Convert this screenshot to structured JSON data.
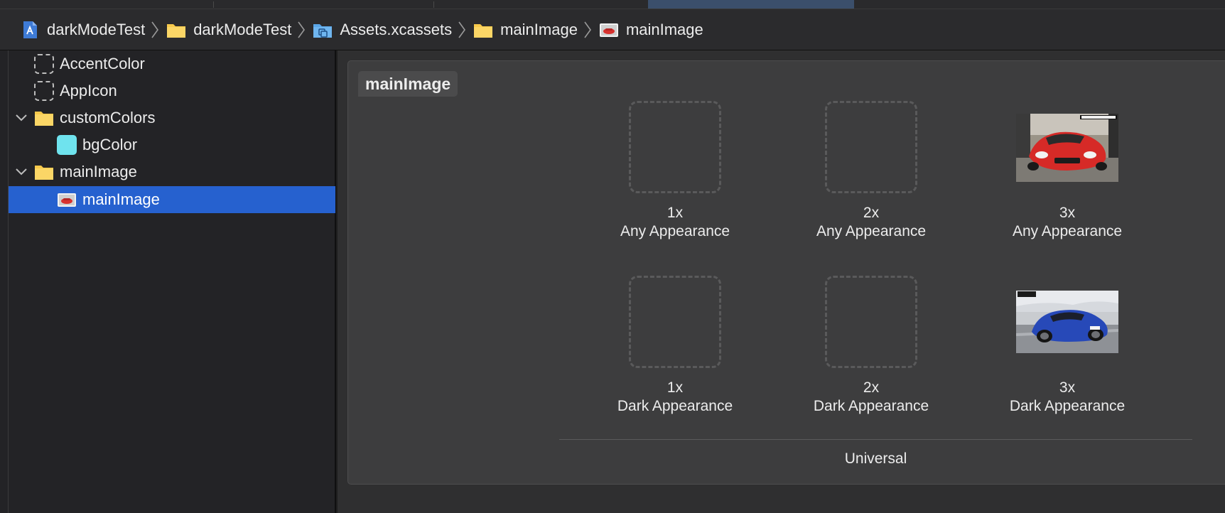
{
  "breadcrumb": [
    {
      "label": "darkModeTest",
      "icon": "project-icon"
    },
    {
      "label": "darkModeTest",
      "icon": "folder-icon"
    },
    {
      "label": "Assets.xcassets",
      "icon": "asset-catalog-icon"
    },
    {
      "label": "mainImage",
      "icon": "folder-icon"
    },
    {
      "label": "mainImage",
      "icon": "image-set-icon"
    }
  ],
  "sidebar": {
    "items": [
      {
        "label": "AccentColor",
        "icon": "color-set-dashed-icon",
        "expanded": null
      },
      {
        "label": "AppIcon",
        "icon": "app-icon-set-dashed-icon",
        "expanded": null
      },
      {
        "label": "customColors",
        "icon": "folder-icon",
        "expanded": true
      },
      {
        "label": "bgColor",
        "icon": "color-swatch-icon",
        "expanded": null
      },
      {
        "label": "mainImage",
        "icon": "folder-icon",
        "expanded": true
      },
      {
        "label": "mainImage",
        "icon": "image-set-icon",
        "expanded": null,
        "selected": true
      }
    ]
  },
  "editor": {
    "asset_name": "mainImage",
    "slots": [
      {
        "scale": "1x",
        "appearance": "Any Appearance",
        "filled": false
      },
      {
        "scale": "2x",
        "appearance": "Any Appearance",
        "filled": false
      },
      {
        "scale": "3x",
        "appearance": "Any Appearance",
        "filled": true,
        "image": "red-sports-car"
      },
      {
        "scale": "1x",
        "appearance": "Dark Appearance",
        "filled": false
      },
      {
        "scale": "2x",
        "appearance": "Dark Appearance",
        "filled": false
      },
      {
        "scale": "3x",
        "appearance": "Dark Appearance",
        "filled": true,
        "image": "blue-sports-car"
      }
    ],
    "group_label": "Universal"
  },
  "colors": {
    "selection": "#2661cf",
    "swatch": "#6fe3ee",
    "folder": "#f7c94b"
  }
}
